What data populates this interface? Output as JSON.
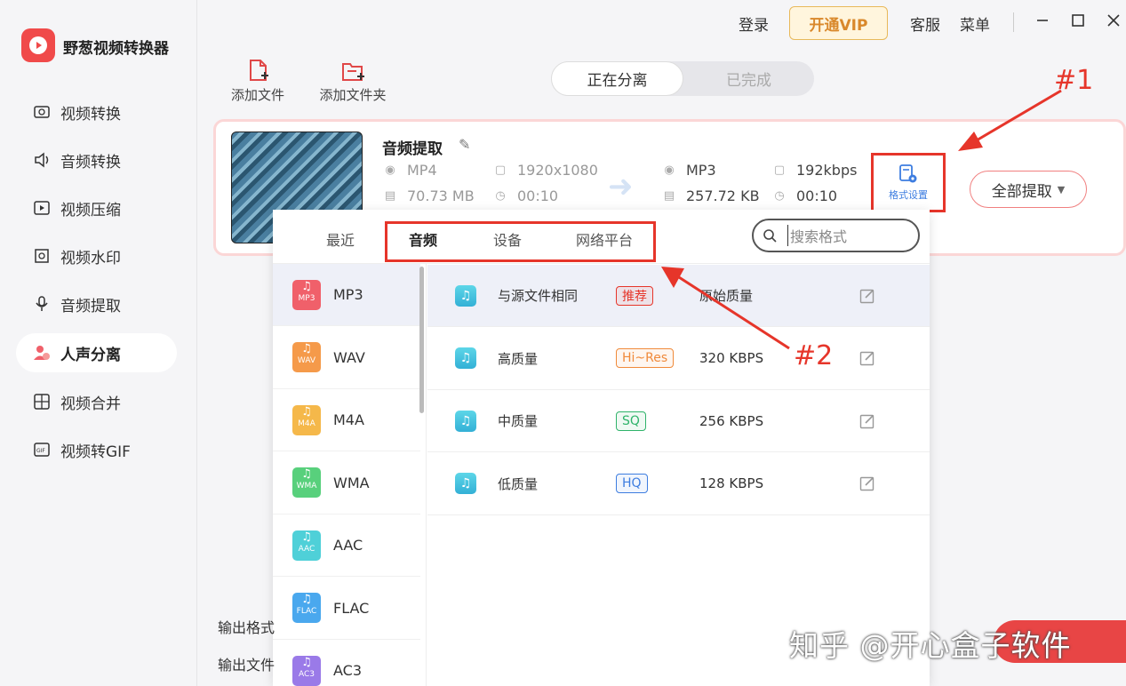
{
  "app": {
    "title": "野葱视频转换器"
  },
  "sidebar": {
    "items": [
      {
        "label": "视频转换",
        "icon": "video-convert-icon"
      },
      {
        "label": "音频转换",
        "icon": "audio-convert-icon"
      },
      {
        "label": "视频压缩",
        "icon": "video-compress-icon"
      },
      {
        "label": "视频水印",
        "icon": "watermark-icon"
      },
      {
        "label": "音频提取",
        "icon": "mic-icon"
      },
      {
        "label": "人声分离",
        "icon": "vocal-separate-icon",
        "active": true
      },
      {
        "label": "视频合并",
        "icon": "merge-icon"
      },
      {
        "label": "视频转GIF",
        "icon": "gif-icon"
      }
    ]
  },
  "titlebar": {
    "login": "登录",
    "vip": "开通VIP",
    "service": "客服",
    "menu": "菜单"
  },
  "toolbar": {
    "add_file": "添加文件",
    "add_folder": "添加文件夹"
  },
  "status_tabs": {
    "processing": "正在分离",
    "done": "已完成"
  },
  "file": {
    "name": "音频提取",
    "src_format": "MP4",
    "src_resolution": "1920x1080",
    "src_size": "70.73 MB",
    "src_duration": "00:10",
    "out_format": "MP3",
    "out_bitrate": "192kbps",
    "out_size": "257.72 KB",
    "out_duration": "00:10"
  },
  "format_settings_label": "格式设置",
  "extract_all": "全部提取",
  "panel": {
    "tabs": {
      "recent": "最近",
      "audio": "音频",
      "device": "设备",
      "web": "网络平台"
    },
    "search_placeholder": "搜索格式",
    "formats": [
      {
        "name": "MP3",
        "color": "#f0606a"
      },
      {
        "name": "WAV",
        "color": "#f59a4a"
      },
      {
        "name": "M4A",
        "color": "#f5b84a"
      },
      {
        "name": "WMA",
        "color": "#58d07c"
      },
      {
        "name": "AAC",
        "color": "#4fd0d8"
      },
      {
        "name": "FLAC",
        "color": "#4aa8ee"
      },
      {
        "name": "AC3",
        "color": "#9a7ae8"
      }
    ],
    "qualities": [
      {
        "name": "与源文件相同",
        "badge": "推荐",
        "badge_color": "#e6352a",
        "value": "原始质量"
      },
      {
        "name": "高质量",
        "badge": "Hi~Res",
        "badge_color": "#f08a3a",
        "value": "320 KBPS"
      },
      {
        "name": "中质量",
        "badge": "SQ",
        "badge_color": "#2fb36a",
        "value": "256 KBPS"
      },
      {
        "name": "低质量",
        "badge": "HQ",
        "badge_color": "#3d7de0",
        "value": "128 KBPS"
      }
    ]
  },
  "annotations": {
    "one": "#1",
    "two": "#2"
  },
  "bottom": {
    "output_format": "输出格式",
    "output_file": "输出文件"
  },
  "watermark": "知乎 @开心盒子软件"
}
